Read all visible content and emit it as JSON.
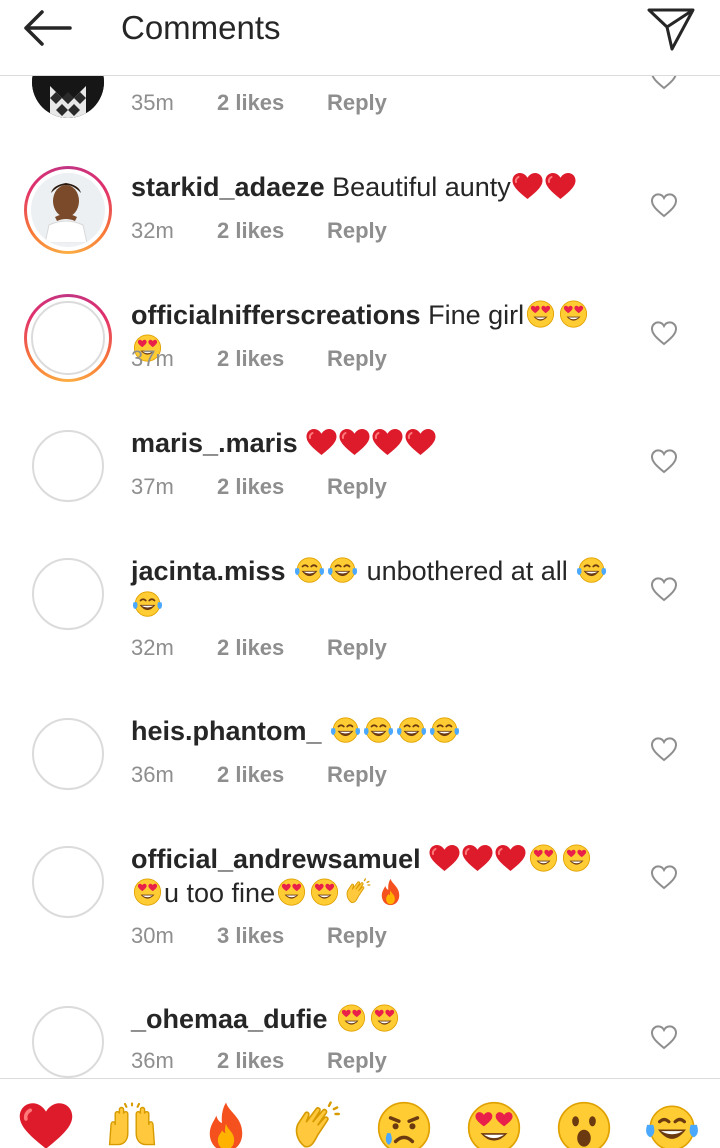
{
  "header": {
    "title": "Comments"
  },
  "comments": [
    {
      "username": "",
      "text": "",
      "time": "35m",
      "likes": "2 likes",
      "reply": "Reply",
      "avatar": "photo-partial"
    },
    {
      "username": "starkid_adaeze",
      "text": "Beautiful aunty",
      "emojis": [
        "red-heart",
        "red-heart"
      ],
      "time": "32m",
      "likes": "2 likes",
      "reply": "Reply",
      "avatar": "story-photo"
    },
    {
      "username": "officialnifferscreations",
      "text": "Fine girl",
      "emojis": [
        "heart-eyes",
        "heart-eyes",
        "heart-eyes"
      ],
      "time": "37m",
      "likes": "2 likes",
      "reply": "Reply",
      "avatar": "story-empty"
    },
    {
      "username": "maris_.maris",
      "text": "",
      "emojis": [
        "red-heart",
        "red-heart",
        "red-heart",
        "red-heart"
      ],
      "time": "37m",
      "likes": "2 likes",
      "reply": "Reply",
      "avatar": "empty"
    },
    {
      "username": "jacinta.miss",
      "text": "unbothered at all",
      "time": "32m",
      "likes": "2 likes",
      "reply": "Reply",
      "avatar": "empty"
    },
    {
      "username": "heis.phantom_",
      "text": "",
      "emojis": [
        "tears-of-joy",
        "tears-of-joy",
        "tears-of-joy",
        "tears-of-joy"
      ],
      "time": "36m",
      "likes": "2 likes",
      "reply": "Reply",
      "avatar": "empty"
    },
    {
      "username": "official_andrewsamuel",
      "text": "u too fine",
      "time": "30m",
      "likes": "3 likes",
      "reply": "Reply",
      "avatar": "empty"
    },
    {
      "username": "_ohemaa_dufie",
      "text": "",
      "emojis": [
        "heart-eyes",
        "heart-eyes"
      ],
      "time": "36m",
      "likes": "2 likes",
      "reply": "Reply",
      "avatar": "empty"
    }
  ],
  "emoji_bar": [
    "red-heart",
    "raising-hands",
    "fire",
    "clapping-hands",
    "crying-face",
    "heart-eyes",
    "astonished-face",
    "tears-of-joy"
  ],
  "colors": {
    "text": "#262626",
    "meta": "#8e8e8e",
    "divider": "#dbdbdb",
    "heart": "#e0245e",
    "story_ring": "#e1306c"
  }
}
